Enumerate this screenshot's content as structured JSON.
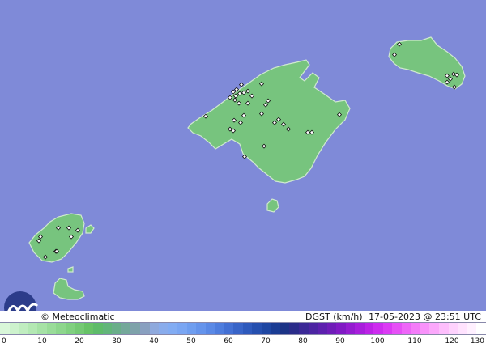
{
  "credit": "© Meteoclimatic",
  "variable_label": "DGST (km/h)",
  "datetime_label": "17-05-2023 @ 23:51 UTC",
  "colors": {
    "sea": "#7f8ad8",
    "land": "#77c47e",
    "land_stroke": "#cfe9cf",
    "station_marker": "#111111"
  },
  "legend": {
    "ticks": [
      "0",
      "10",
      "20",
      "30",
      "40",
      "50",
      "60",
      "70",
      "80",
      "90",
      "100",
      "110",
      "120",
      "130"
    ],
    "colors": [
      "#d9f7d9",
      "#cdf2cd",
      "#c0edc0",
      "#b3e8b3",
      "#a6e2a6",
      "#99dc99",
      "#8dd68d",
      "#80d080",
      "#74c974",
      "#67c267",
      "#5ebb6a",
      "#62b57a",
      "#6aae8a",
      "#74a89a",
      "#7ea2aa",
      "#89a0c0",
      "#8ea9dd",
      "#89acec",
      "#82acf3",
      "#7aa6f3",
      "#6f9ef0",
      "#6594ec",
      "#5a89e6",
      "#4e7dde",
      "#4370d4",
      "#3864c8",
      "#2e59bc",
      "#254faf",
      "#1e46a2",
      "#1a3c94",
      "#1b3386",
      "#2a2c8a",
      "#3a2896",
      "#4b24a2",
      "#5c20ae",
      "#6e1cb8",
      "#801ac4",
      "#941cd0",
      "#a81edc",
      "#bc22e6",
      "#cd2cef",
      "#db3af4",
      "#e650f6",
      "#ee66f8",
      "#f47cf9",
      "#f892fa",
      "#fba8fb",
      "#fdbefc",
      "#fed2fd",
      "#ffe2fe",
      "#fff0ff",
      "#ffffff"
    ]
  },
  "stations": [
    [
      493,
      55
    ],
    [
      487,
      68
    ],
    [
      552,
      94
    ],
    [
      560,
      92
    ],
    [
      556,
      98
    ],
    [
      564,
      93
    ],
    [
      552,
      102
    ],
    [
      561,
      108
    ],
    [
      323,
      104
    ],
    [
      298,
      105
    ],
    [
      292,
      111
    ],
    [
      288,
      114
    ],
    [
      296,
      116
    ],
    [
      291,
      119
    ],
    [
      290,
      124
    ],
    [
      284,
      121
    ],
    [
      306,
      113
    ],
    [
      301,
      115
    ],
    [
      311,
      119
    ],
    [
      295,
      128
    ],
    [
      306,
      128
    ],
    [
      328,
      130
    ],
    [
      331,
      125
    ],
    [
      323,
      141
    ],
    [
      301,
      143
    ],
    [
      289,
      149
    ],
    [
      297,
      152
    ],
    [
      284,
      160
    ],
    [
      288,
      162
    ],
    [
      344,
      148
    ],
    [
      350,
      154
    ],
    [
      356,
      160
    ],
    [
      380,
      164
    ],
    [
      385,
      164
    ],
    [
      254,
      144
    ],
    [
      326,
      181
    ],
    [
      302,
      194
    ],
    [
      419,
      142
    ],
    [
      339,
      152
    ],
    [
      72,
      282
    ],
    [
      85,
      282
    ],
    [
      96,
      285
    ],
    [
      50,
      293
    ],
    [
      48,
      298
    ],
    [
      88,
      293
    ],
    [
      69,
      311
    ],
    [
      70,
      311
    ],
    [
      56,
      318
    ]
  ]
}
